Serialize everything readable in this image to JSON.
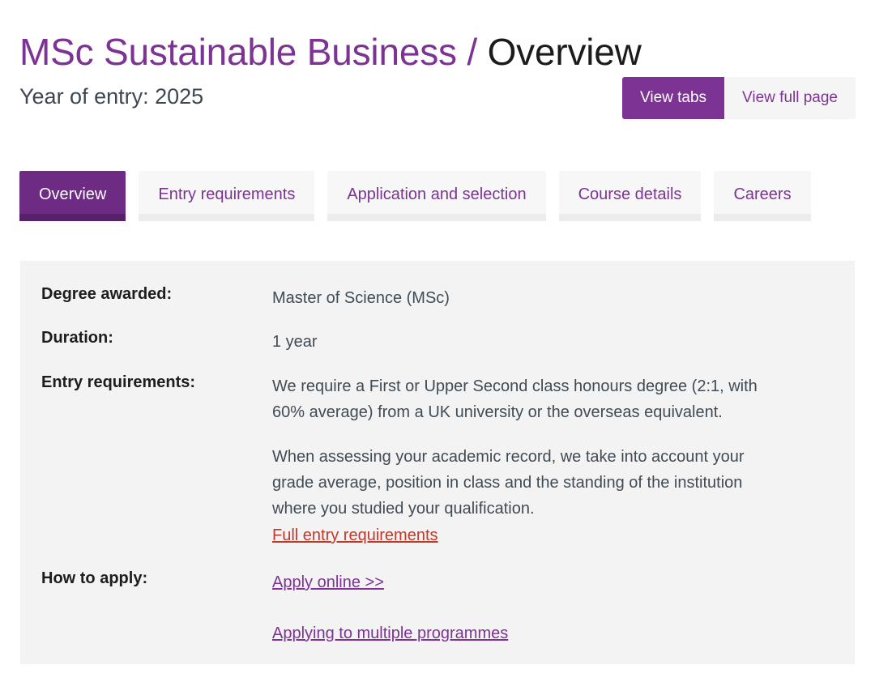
{
  "header": {
    "course_title": "MSc Sustainable Business",
    "separator": "/",
    "section_title": "Overview",
    "year_of_entry": "Year of entry: 2025"
  },
  "view_toggle": {
    "tabs_label": "View tabs",
    "full_page_label": "View full page",
    "active": "View tabs"
  },
  "tabs": [
    {
      "label": "Overview",
      "active": true
    },
    {
      "label": "Entry requirements",
      "active": false
    },
    {
      "label": "Application and selection",
      "active": false
    },
    {
      "label": "Course details",
      "active": false
    },
    {
      "label": "Careers",
      "active": false
    }
  ],
  "overview": {
    "rows": [
      {
        "label": "Degree awarded:",
        "value": "Master of Science (MSc)"
      },
      {
        "label": "Duration:",
        "value": "1 year"
      },
      {
        "label": "Entry requirements:",
        "paragraph_1": "We require a First or Upper Second class honours degree (2:1, with 60% average) from a UK university or the overseas equivalent.",
        "paragraph_2": "When assessing your academic record, we take into account your grade average, position in class and the standing of the institution where you studied your qualification.",
        "link_label": "Full entry requirements"
      },
      {
        "label": "How to apply:",
        "link_1": "Apply online >>",
        "link_2": "Applying to multiple programmes"
      }
    ]
  },
  "colors": {
    "brand_purple": "#7c3393",
    "active_tab_purple": "#6d2b84",
    "active_tab_underline": "#56206a",
    "link_red": "#c0392b",
    "panel_bg": "#f3f3f4",
    "tab_bg": "#f7f7f7",
    "tab_underline": "#ececec",
    "body_text": "#414b54",
    "label_text": "#1d1d1d"
  }
}
